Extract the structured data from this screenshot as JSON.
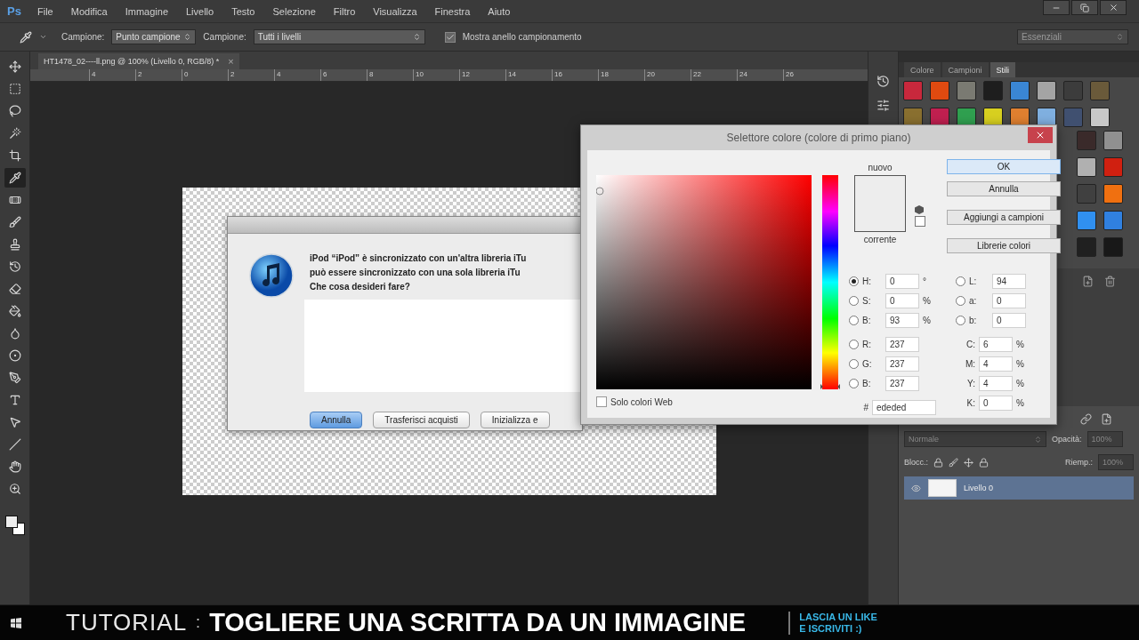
{
  "app": {
    "logo": "Ps",
    "menu": [
      "File",
      "Modifica",
      "Immagine",
      "Livello",
      "Testo",
      "Selezione",
      "Filtro",
      "Visualizza",
      "Finestra",
      "Aiuto"
    ]
  },
  "options_bar": {
    "selects": [
      {
        "label": "Campione:",
        "value": "Punto campione"
      },
      {
        "label": "Campione:",
        "value": "Tutti i livelli"
      }
    ],
    "checkbox": {
      "label": "Mostra anello campionamento",
      "checked": true
    },
    "workspace": "Essenziali"
  },
  "tools": [
    {
      "kind": "move",
      "selected": false
    },
    {
      "kind": "marquee",
      "selected": false
    },
    {
      "kind": "lasso",
      "selected": false
    },
    {
      "kind": "wand",
      "selected": false
    },
    {
      "kind": "crop",
      "selected": false
    },
    {
      "kind": "eyedropper",
      "selected": true
    },
    {
      "kind": "healing",
      "selected": false
    },
    {
      "kind": "brush",
      "selected": false
    },
    {
      "kind": "stamp",
      "selected": false
    },
    {
      "kind": "history",
      "selected": false
    },
    {
      "kind": "eraser",
      "selected": false
    },
    {
      "kind": "bucket",
      "selected": false
    },
    {
      "kind": "blur",
      "selected": false
    },
    {
      "kind": "dodge",
      "selected": false
    },
    {
      "kind": "pen",
      "selected": false
    },
    {
      "kind": "type",
      "selected": false
    },
    {
      "kind": "path",
      "selected": false
    },
    {
      "kind": "line",
      "selected": false
    },
    {
      "kind": "hand",
      "selected": false
    },
    {
      "kind": "zoom",
      "selected": false
    }
  ],
  "document": {
    "tab": "HT1478_02----ll.png @ 100% (Livello 0, RGB/8) *",
    "close": "×",
    "ruler": [
      "4",
      "2",
      "0",
      "2",
      "4",
      "6",
      "8",
      "10",
      "12",
      "14",
      "16",
      "18",
      "20",
      "22",
      "24",
      "26"
    ]
  },
  "itunes_dialog": {
    "message": [
      "iPod “iPod” è sincronizzato con un'altra libreria iTu",
      "può essere sincronizzato con una sola libreria iTu",
      "Che cosa desideri fare?"
    ],
    "buttons": [
      {
        "label": "Annulla",
        "default": true
      },
      {
        "label": "Trasferisci acquisti",
        "default": false
      },
      {
        "label": "Inizializza e",
        "default": false
      }
    ]
  },
  "color_picker": {
    "title": "Selettore colore (colore di primo piano)",
    "new_label": "nuovo",
    "current_label": "corrente",
    "buttons": [
      {
        "label": "OK",
        "focused": true
      },
      {
        "label": "Annulla",
        "focused": false
      },
      {
        "label": "Aggiungi a campioni",
        "focused": false
      },
      {
        "label": "Librerie colori",
        "focused": false
      }
    ],
    "hsb": [
      {
        "label": "H:",
        "value": "0",
        "unit": "°",
        "selected": true
      },
      {
        "label": "S:",
        "value": "0",
        "unit": "%",
        "selected": false
      },
      {
        "label": "B:",
        "value": "93",
        "unit": "%",
        "selected": false
      }
    ],
    "rgb": [
      {
        "label": "R:",
        "value": "237",
        "selected": false
      },
      {
        "label": "G:",
        "value": "237",
        "selected": false
      },
      {
        "label": "B:",
        "value": "237",
        "selected": false
      }
    ],
    "lab": [
      {
        "label": "L:",
        "value": "94",
        "selected": false
      },
      {
        "label": "a:",
        "value": "0",
        "selected": false
      },
      {
        "label": "b:",
        "value": "0",
        "selected": false
      }
    ],
    "cmyk": [
      {
        "label": "C:",
        "value": "6",
        "unit": "%"
      },
      {
        "label": "M:",
        "value": "4",
        "unit": "%"
      },
      {
        "label": "Y:",
        "value": "4",
        "unit": "%"
      },
      {
        "label": "K:",
        "value": "0",
        "unit": "%"
      }
    ],
    "hue_slider": {
      "level": 0
    },
    "hex": {
      "label": "#",
      "value": "ededed"
    },
    "web_only": {
      "label": "Solo colori Web",
      "checked": false
    }
  },
  "panels": {
    "tabs": [
      {
        "label": "Colore",
        "selected": false
      },
      {
        "label": "Campioni",
        "selected": false
      },
      {
        "label": "Stili",
        "selected": true
      }
    ],
    "styles": [
      {
        "color": "#c8283c"
      },
      {
        "color": "#e04a10"
      },
      {
        "color": "#7a7a72"
      },
      {
        "color": "#1e1e1e"
      },
      {
        "color": "#3a86d4"
      },
      {
        "color": "#a4a4a4"
      },
      {
        "color": "#3c3c3c"
      },
      {
        "color": "#6a5a3a"
      },
      {
        "color": "#8a7030"
      },
      {
        "color": "#c02050"
      },
      {
        "color": "#30a050"
      },
      {
        "color": "#d8d020"
      },
      {
        "color": "#e08030"
      },
      {
        "color": "#80b0e0"
      },
      {
        "color": "#405070"
      },
      {
        "color": "#c8c8c8"
      }
    ],
    "styles_right": [
      {
        "color": "#3a2a2a"
      },
      {
        "color": "#909090"
      },
      {
        "color": "#b0b0b0"
      },
      {
        "color": "#d02010"
      },
      {
        "color": "#404040"
      },
      {
        "color": "#f07010"
      },
      {
        "color": "#3090f0"
      },
      {
        "color": "#3080e0"
      },
      {
        "color": "#202020"
      },
      {
        "color": "#181818"
      }
    ]
  },
  "layers": {
    "blend_mode": "Normale",
    "opacity_label": "Opacità:",
    "opacity": "100%",
    "lock_label": "Blocc.:",
    "fill_label": "Riemp.:",
    "fill": "100%",
    "rows": [
      {
        "name": "Livello 0",
        "selected": true,
        "visible": true
      }
    ]
  },
  "banner": {
    "prefix": "TUTORIAL",
    "separator": ":",
    "title": "TOGLIERE UNA SCRITTA DA UN IMMAGINE",
    "call_to_action": [
      "LASCIA UN LIKE",
      "E ISCRIVITI :)"
    ]
  }
}
